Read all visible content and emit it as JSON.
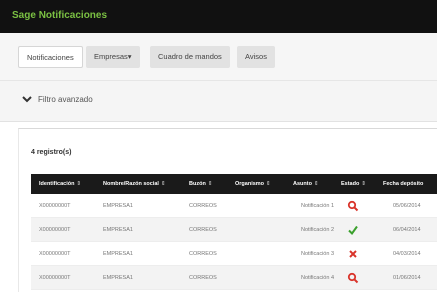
{
  "app": {
    "brand": "Sage",
    "title": "Notificaciones"
  },
  "nav": {
    "tabs": [
      {
        "label": "Notificaciones"
      },
      {
        "label": "Empresas▾"
      },
      {
        "label": "Cuadro de mandos"
      },
      {
        "label": "Avisos"
      }
    ]
  },
  "filter": {
    "label": "Filtro avanzado"
  },
  "table": {
    "count": "4 registro(s)",
    "headers": [
      "Identificación",
      "Nombre/Razón social",
      "Buzón",
      "Organismo",
      "Asunto",
      "Estado",
      "Fecha depósito"
    ],
    "rows": [
      {
        "id": "X00000000T",
        "name": "EMPRESA1",
        "mailbox": "CORREOS",
        "organism": "",
        "subject": "Notificación 1",
        "status_icon": "search-red-icon",
        "date": "05/06/2014"
      },
      {
        "id": "X00000000T",
        "name": "EMPRESA1",
        "mailbox": "CORREOS",
        "organism": "",
        "subject": "Notificación 2",
        "status_icon": "check-icon",
        "date": "06/04/2014"
      },
      {
        "id": "X00000000T",
        "name": "EMPRESA1",
        "mailbox": "CORREOS",
        "organism": "",
        "subject": "Notificación 3",
        "status_icon": "cross-icon",
        "date": "04/03/2014"
      },
      {
        "id": "X00000000T",
        "name": "EMPRESA1",
        "mailbox": "CORREOS",
        "organism": "",
        "subject": "Notificación 4",
        "status_icon": "search-red-icon",
        "date": "01/06/2014"
      }
    ]
  },
  "colors": {
    "brand": "#7bc143",
    "header_bg": "#1a1a1a",
    "status_red": "#d9342b",
    "status_green": "#3aa02c"
  }
}
